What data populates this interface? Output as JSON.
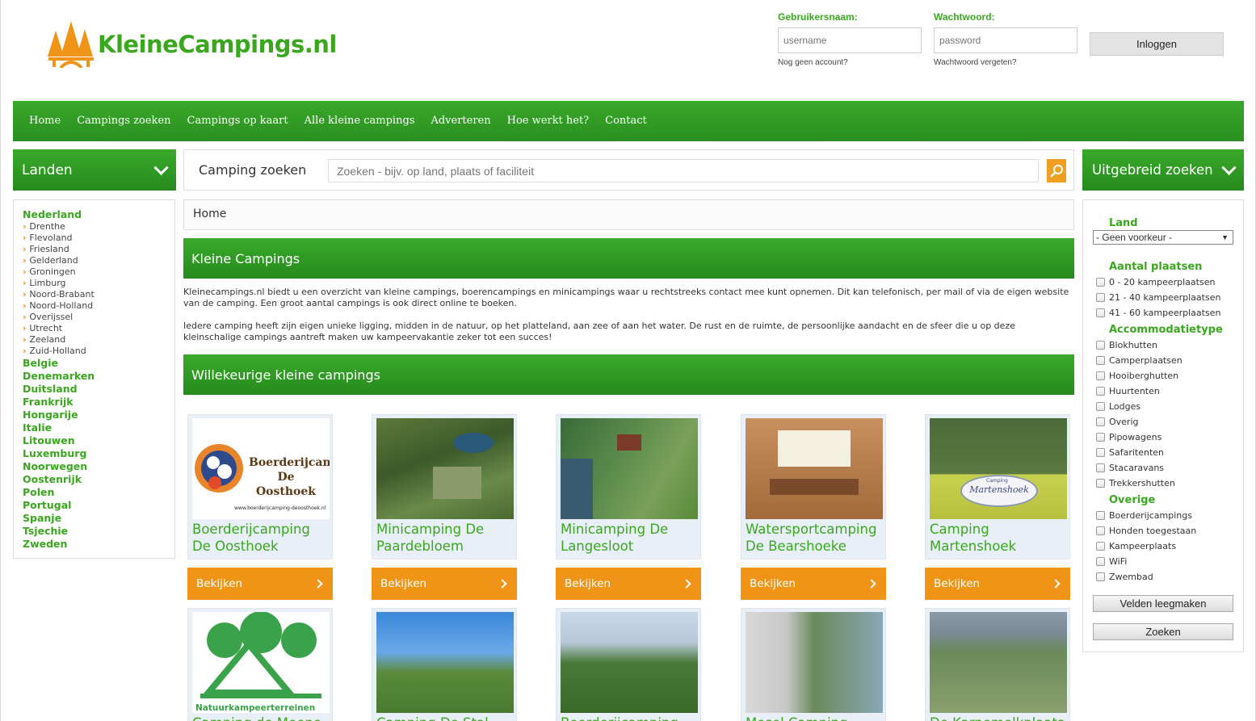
{
  "header": {
    "logo_text": "KleineCampings.nl",
    "username_label": "Gebruikersnaam:",
    "username_placeholder": "username",
    "password_label": "Wachtwoord:",
    "password_placeholder": "password",
    "no_account_link": "Nog geen account?",
    "forgot_link": "Wachtwoord vergeten?",
    "login_button": "Inloggen"
  },
  "nav": {
    "items": [
      "Home",
      "Campings zoeken",
      "Campings op kaart",
      "Alle kleine campings",
      "Adverteren",
      "Hoe werkt het?",
      "Contact"
    ]
  },
  "left": {
    "title": "Landen",
    "featured_country": "Nederland",
    "provinces": [
      "Drenthe",
      "Flevoland",
      "Friesland",
      "Gelderland",
      "Groningen",
      "Limburg",
      "Noord-Brabant",
      "Noord-Holland",
      "Overijssel",
      "Utrecht",
      "Zeeland",
      "Zuid-Holland"
    ],
    "countries": [
      "Belgie",
      "Denemarken",
      "Duitsland",
      "Frankrijk",
      "Hongarije",
      "Italie",
      "Litouwen",
      "Luxemburg",
      "Noorwegen",
      "Oostenrijk",
      "Polen",
      "Portugal",
      "Spanje",
      "Tsjechie",
      "Zweden"
    ]
  },
  "search": {
    "label": "Camping zoeken",
    "placeholder": "Zoeken - bijv. op land, plaats of faciliteit"
  },
  "breadcrumb": "Home",
  "main": {
    "section1_title": "Kleine Campings",
    "intro1": "Kleinecampings.nl biedt u een overzicht van kleine campings, boerencampings en minicampings waar u rechtstreeks contact mee kunt opnemen. Dit kan telefonisch, per mail of via de eigen website van de camping. Een groot aantal campings is ook direct online te boeken.",
    "intro2": "Iedere camping heeft zijn eigen unieke ligging, midden in de natuur, op het platteland, aan zee of aan het water. De rust en de ruimte, de persoonlijke aandacht en de sfeer die u op deze kleinschalige campings aantreft maken uw kampeervakantie zeker tot een succes!",
    "section2_title": "Willekeurige kleine campings",
    "view_label": "Bekijken",
    "cards_row1": [
      {
        "title": "Boerderijcamping De Oosthoek",
        "image_text": "Boerderijcamping De Oosthoek",
        "image_url": "www.boerderijcamping-deoosthoek.nl"
      },
      {
        "title": "Minicamping De Paardebloem"
      },
      {
        "title": "Minicamping De Langesloot"
      },
      {
        "title": "Watersportcamping De Bearshoeke"
      },
      {
        "title": "Camping Martenshoek",
        "image_text": "Martenshoek",
        "image_small": "Camping"
      }
    ],
    "cards_row2": [
      {
        "title": "Camping de Meene",
        "image_text": "Natuurkampeerterreinen"
      },
      {
        "title": "Camping De Stal"
      },
      {
        "title": "Boerderijcamping"
      },
      {
        "title": "Mosel Camping"
      },
      {
        "title": "De Karnemelkplaats"
      }
    ]
  },
  "right": {
    "title": "Uitgebreid zoeken",
    "land_label": "Land",
    "land_value": "- Geen voorkeur -",
    "places_label": "Aantal plaatsen",
    "places": [
      "0 - 20 kampeerplaatsen",
      "21 - 40 kampeerplaatsen",
      "41 - 60 kampeerplaatsen"
    ],
    "accom_label": "Accommodatietype",
    "accom": [
      "Blokhutten",
      "Camperplaatsen",
      "Hooiberghutten",
      "Huurtenten",
      "Lodges",
      "Overig",
      "Pipowagens",
      "Safaritenten",
      "Stacaravans",
      "Trekkershutten"
    ],
    "other_label": "Overige",
    "other": [
      "Boerderijcampings",
      "Honden toegestaan",
      "Kampeerplaats",
      "WiFi",
      "Zwembad"
    ],
    "clear_button": "Velden leegmaken",
    "search_button": "Zoeken"
  }
}
